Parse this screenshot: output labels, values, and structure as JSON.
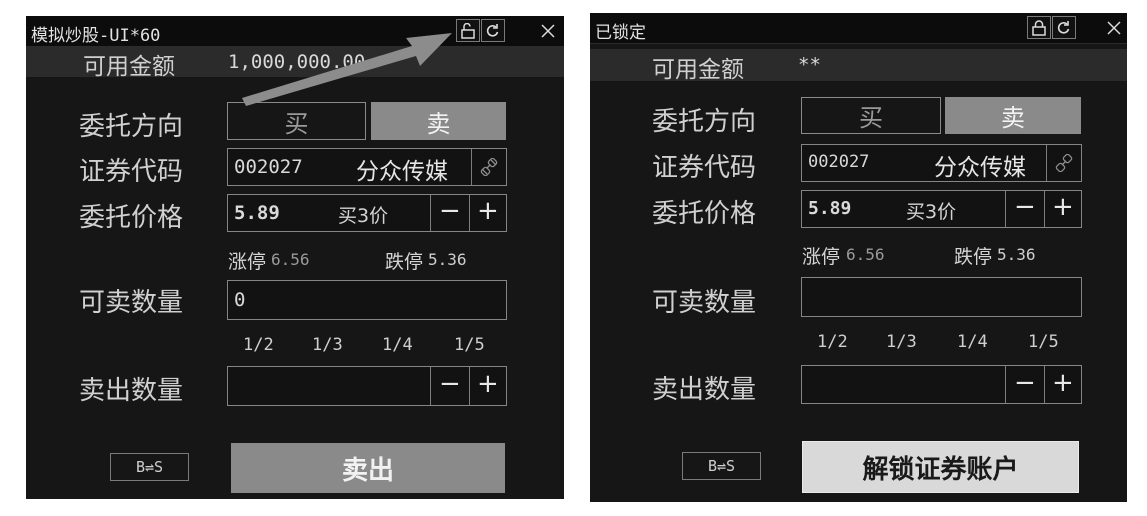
{
  "left": {
    "title": "模拟炒股-UI*60",
    "balance_label": "可用金额",
    "balance_value": "1,000,000.00",
    "direction_label": "委托方向",
    "buy_label": "买",
    "sell_label": "卖",
    "code_label": "证券代码",
    "code_value": "002027",
    "stock_name": "分众传媒",
    "price_label": "委托价格",
    "price_value": "5.89",
    "price_type": "买3价",
    "minus": "−",
    "plus": "+",
    "limit_up_label": "涨停",
    "limit_up_value": "6.56",
    "limit_down_label": "跌停",
    "limit_down_value": "5.36",
    "sellable_label": "可卖数量",
    "sellable_value": "0",
    "fractions": [
      "1/2",
      "1/3",
      "1/4",
      "1/5"
    ],
    "sell_qty_label": "卖出数量",
    "sell_qty_value": "",
    "switch_label": "B⇌S",
    "submit_label": "卖出"
  },
  "right": {
    "title": "已锁定",
    "balance_label": "可用金额",
    "balance_value": "**",
    "direction_label": "委托方向",
    "buy_label": "买",
    "sell_label": "卖",
    "code_label": "证券代码",
    "code_value": "002027",
    "stock_name": "分众传媒",
    "price_label": "委托价格",
    "price_value": "5.89",
    "price_type": "买3价",
    "minus": "−",
    "plus": "+",
    "limit_up_label": "涨停",
    "limit_up_value": "6.56",
    "limit_down_label": "跌停",
    "limit_down_value": "5.36",
    "sellable_label": "可卖数量",
    "sellable_value": "",
    "fractions": [
      "1/2",
      "1/3",
      "1/4",
      "1/5"
    ],
    "sell_qty_label": "卖出数量",
    "sell_qty_value": "",
    "switch_label": "B⇌S",
    "submit_label": "解锁证券账户"
  },
  "icons": {
    "unlock": "unlock-icon",
    "lock": "lock-icon",
    "refresh": "refresh-icon",
    "close": "close-icon",
    "link": "link-icon"
  },
  "colors": {
    "window_bg": "#161616",
    "sell_active": "#8a8a8a",
    "unlock_button": "#d9d9d9",
    "annotation_arrow": "#8c8c8c"
  }
}
